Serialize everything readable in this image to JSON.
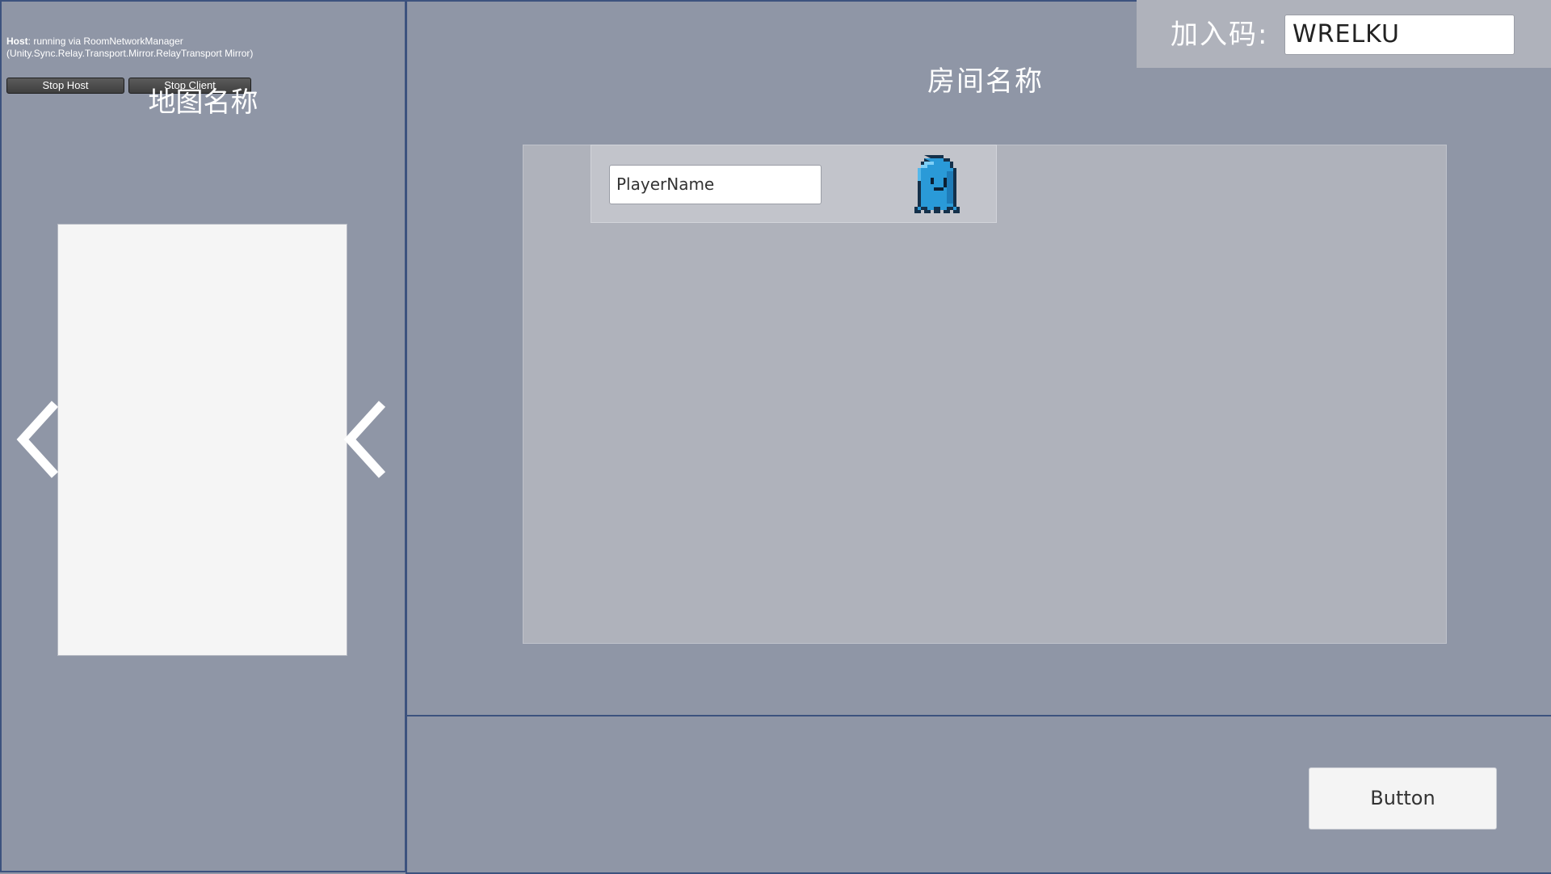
{
  "debug": {
    "host_label": "Host",
    "host_status": ": running via RoomNetworkManager (Unity.Sync.Relay.Transport.Mirror.RelayTransport Mirror)",
    "stop_host_label": "Stop Host",
    "stop_client_label": "Stop Client"
  },
  "map_panel": {
    "title": "地图名称",
    "prev_icon": "chevron-left-icon",
    "next_icon": "chevron-left-icon"
  },
  "room": {
    "title": "房间名称",
    "join_code_label": "加入码:",
    "join_code_value": "WRELKU"
  },
  "players": [
    {
      "name_placeholder": "PlayerName",
      "avatar_icon": "blue-ghost-icon"
    }
  ],
  "footer": {
    "button_label": "Button"
  },
  "colors": {
    "background": "#8f96a6",
    "panel_border": "#3c527e",
    "ghost_blue": "#2a9ad8"
  }
}
